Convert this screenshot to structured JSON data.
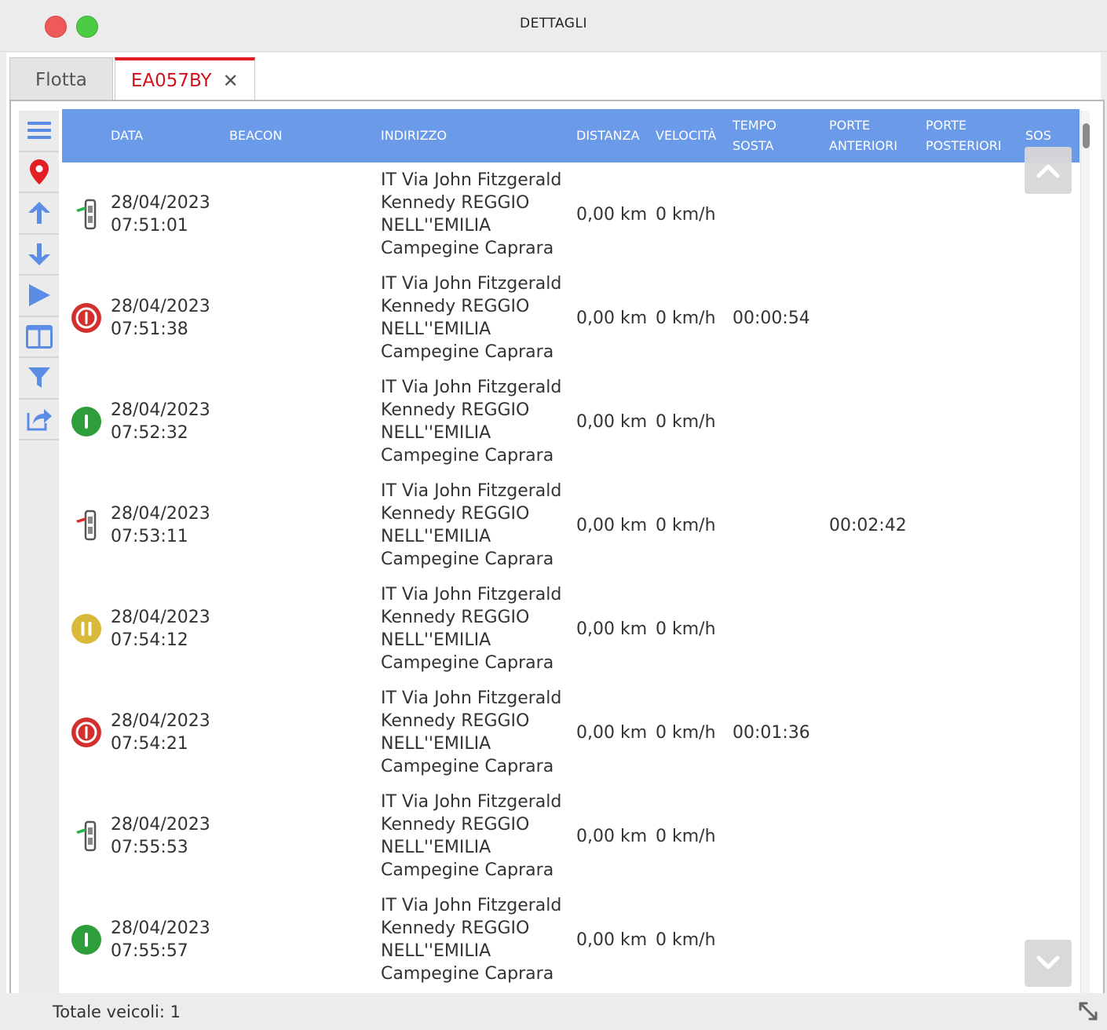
{
  "window": {
    "title": "DETTAGLI"
  },
  "tabs": [
    {
      "label": "Flotta"
    },
    {
      "label": "EA057BY",
      "close_icon": "close-icon"
    }
  ],
  "toolbar": {
    "tools": [
      "menu-icon",
      "map-pin-icon",
      "arrow-up-icon",
      "arrow-down-icon",
      "play-icon",
      "columns-icon",
      "filter-icon",
      "share-icon"
    ]
  },
  "table": {
    "headers": {
      "data": "DATA",
      "beacon": "BEACON",
      "indirizzo": "INDIRIZZO",
      "distanza": "DISTANZA",
      "velocita": "VELOCITÀ",
      "tempo_sosta_1": "TEMPO",
      "tempo_sosta_2": "SOSTA",
      "porte_anteriori_1": "PORTE",
      "porte_anteriori_2": "ANTERIORI",
      "porte_posteriori_1": "PORTE",
      "porte_posteriori_2": "POSTERIORI",
      "sos": "SOS"
    },
    "rows": [
      {
        "icon": "door-open-green-icon",
        "date": "28/04/2023",
        "time": "07:51:01",
        "addr1": "IT Via John Fitzgerald",
        "addr2": "Kennedy REGGIO",
        "addr3": "NELL''EMILIA",
        "addr4": "Campegine Caprara",
        "distanza": "0,00 km",
        "velocita": "0 km/h",
        "tempo_sosta": "",
        "porte_anteriori": ""
      },
      {
        "icon": "engine-off-icon",
        "date": "28/04/2023",
        "time": "07:51:38",
        "addr1": "IT Via John Fitzgerald",
        "addr2": "Kennedy REGGIO",
        "addr3": "NELL''EMILIA",
        "addr4": "Campegine Caprara",
        "distanza": "0,00 km",
        "velocita": "0 km/h",
        "tempo_sosta": "00:00:54",
        "porte_anteriori": ""
      },
      {
        "icon": "engine-on-icon",
        "date": "28/04/2023",
        "time": "07:52:32",
        "addr1": "IT Via John Fitzgerald",
        "addr2": "Kennedy REGGIO",
        "addr3": "NELL''EMILIA",
        "addr4": "Campegine Caprara",
        "distanza": "0,00 km",
        "velocita": "0 km/h",
        "tempo_sosta": "",
        "porte_anteriori": ""
      },
      {
        "icon": "door-open-red-icon",
        "date": "28/04/2023",
        "time": "07:53:11",
        "addr1": "IT Via John Fitzgerald",
        "addr2": "Kennedy REGGIO",
        "addr3": "NELL''EMILIA",
        "addr4": "Campegine Caprara",
        "distanza": "0,00 km",
        "velocita": "0 km/h",
        "tempo_sosta": "",
        "porte_anteriori": "00:02:42"
      },
      {
        "icon": "pause-icon",
        "date": "28/04/2023",
        "time": "07:54:12",
        "addr1": "IT Via John Fitzgerald",
        "addr2": "Kennedy REGGIO",
        "addr3": "NELL''EMILIA",
        "addr4": "Campegine Caprara",
        "distanza": "0,00 km",
        "velocita": "0 km/h",
        "tempo_sosta": "",
        "porte_anteriori": ""
      },
      {
        "icon": "engine-off-icon",
        "date": "28/04/2023",
        "time": "07:54:21",
        "addr1": "IT Via John Fitzgerald",
        "addr2": "Kennedy REGGIO",
        "addr3": "NELL''EMILIA",
        "addr4": "Campegine Caprara",
        "distanza": "0,00 km",
        "velocita": "0 km/h",
        "tempo_sosta": "00:01:36",
        "porte_anteriori": ""
      },
      {
        "icon": "door-open-green-icon",
        "date": "28/04/2023",
        "time": "07:55:53",
        "addr1": "IT Via John Fitzgerald",
        "addr2": "Kennedy REGGIO",
        "addr3": "NELL''EMILIA",
        "addr4": "Campegine Caprara",
        "distanza": "0,00 km",
        "velocita": "0 km/h",
        "tempo_sosta": "",
        "porte_anteriori": ""
      },
      {
        "icon": "engine-on-icon",
        "date": "28/04/2023",
        "time": "07:55:57",
        "addr1": "IT Via John Fitzgerald",
        "addr2": "Kennedy REGGIO",
        "addr3": "NELL''EMILIA",
        "addr4": "Campegine Caprara",
        "distanza": "0,00 km",
        "velocita": "0 km/h",
        "tempo_sosta": "",
        "porte_anteriori": ""
      }
    ]
  },
  "status": {
    "text": "Totale veicoli: 1"
  },
  "colors": {
    "header_bg": "#6b9be8",
    "tab_active": "#d0121b",
    "toolbar_icon": "#5b8de6",
    "pin": "#e41e25"
  }
}
